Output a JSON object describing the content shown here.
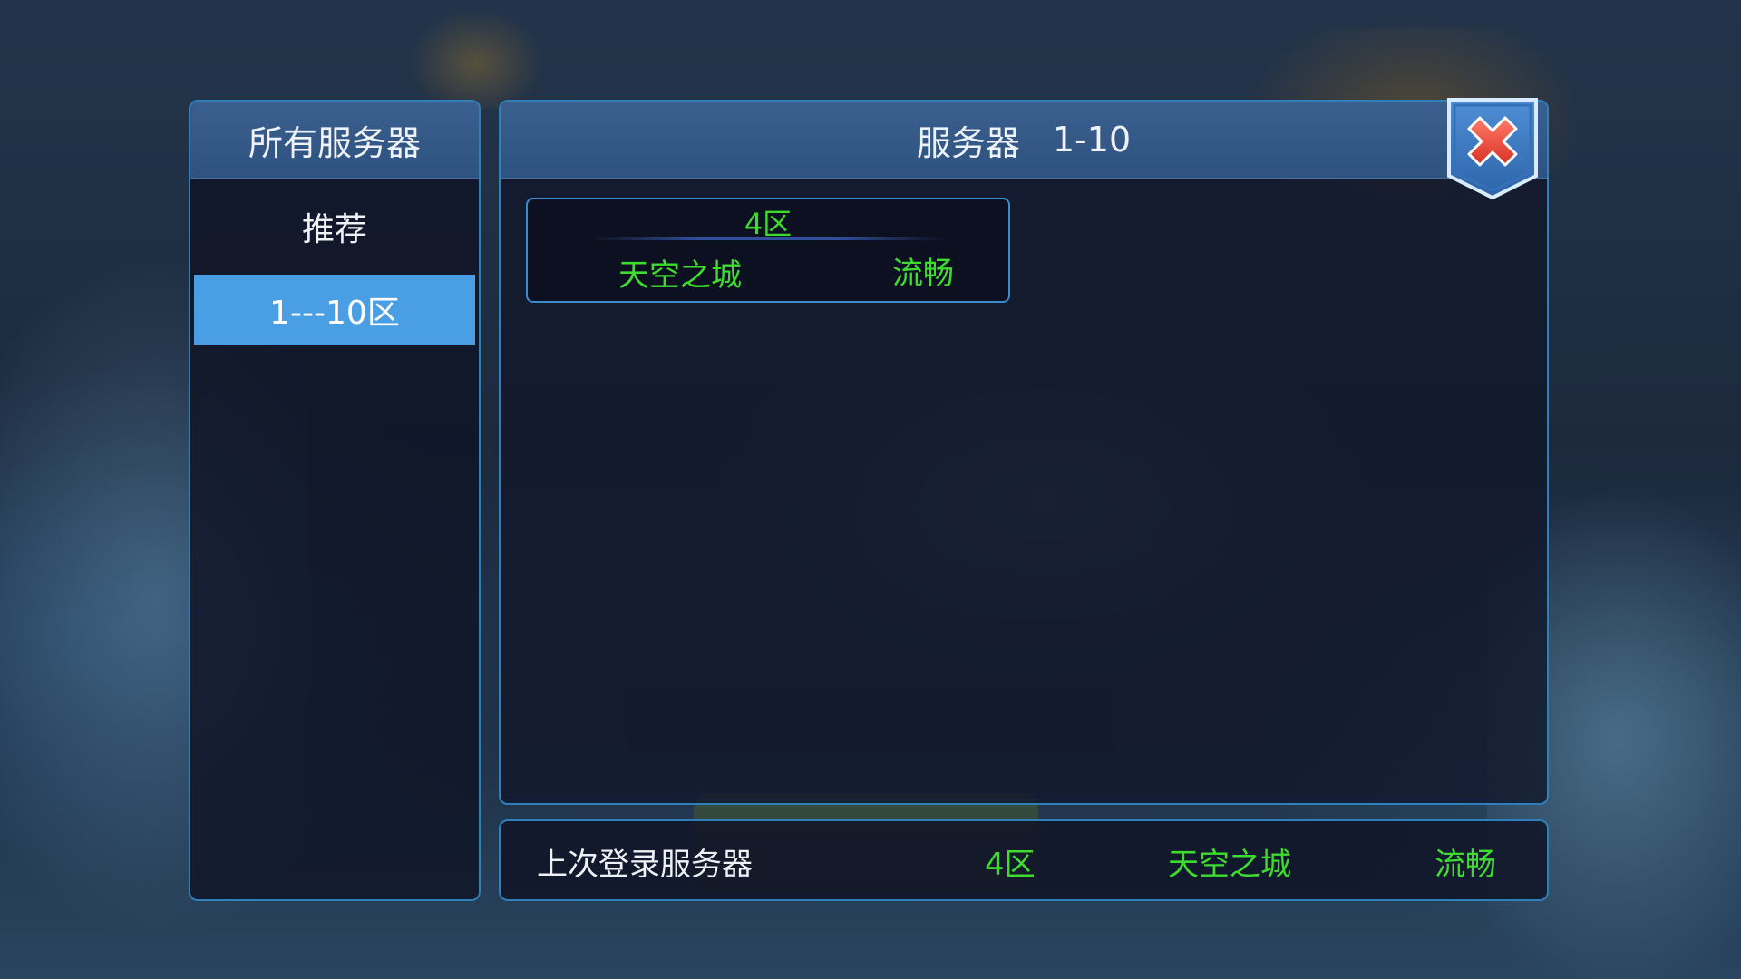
{
  "left_panel": {
    "title": "所有服务器",
    "items": [
      {
        "label": "推荐",
        "selected": false
      },
      {
        "label": "1---10区",
        "selected": true
      }
    ]
  },
  "main_panel": {
    "title": "服务器",
    "range": "1-10",
    "servers": [
      {
        "zone": "4区",
        "name": "天空之城",
        "status": "流畅"
      }
    ]
  },
  "last_login": {
    "label": "上次登录服务器",
    "zone": "4区",
    "name": "天空之城",
    "status": "流畅"
  },
  "colors": {
    "accent_green": "#3ddc2f",
    "panel_border": "#2f7fb8",
    "selected_item": "#4a9fe4",
    "header": "#3a5f8e",
    "close_red": "#e84a3a"
  },
  "icons": {
    "close": "close-icon"
  }
}
